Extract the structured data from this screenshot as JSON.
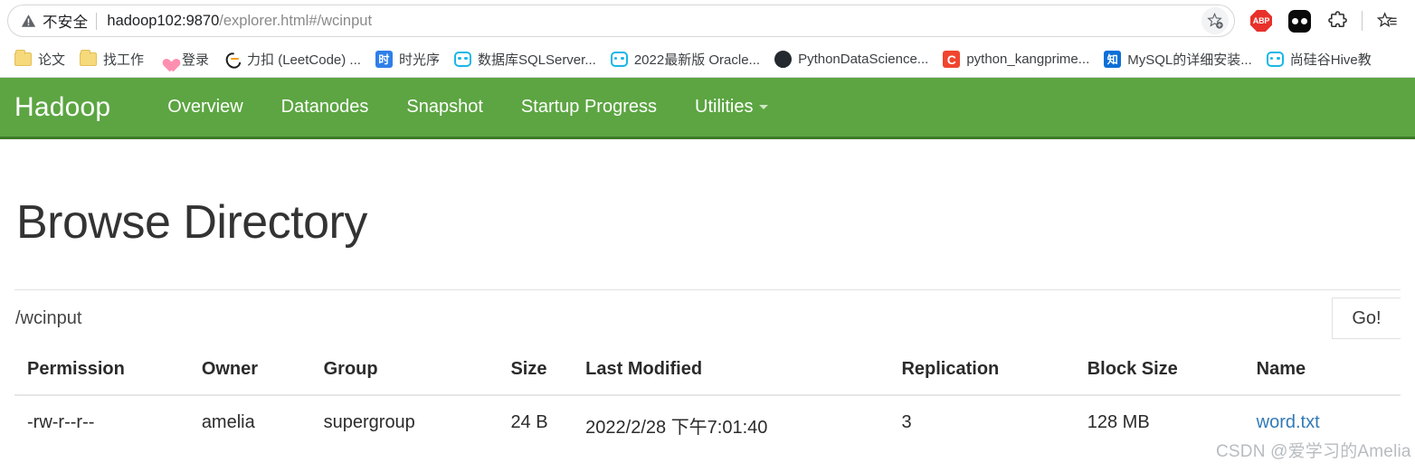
{
  "browser": {
    "security_label": "不安全",
    "url_host": "hadoop102:9870",
    "url_path": "/explorer.html#/wcinput",
    "warning_icon": "warning-triangle-icon",
    "add_favorite_icon": "star-plus-icon",
    "actions": [
      {
        "name": "adblock-plus-icon",
        "label": "ABP"
      },
      {
        "name": "extension-dots-icon",
        "label": ""
      },
      {
        "name": "extensions-puzzle-icon",
        "label": ""
      },
      {
        "name": "collections-icon",
        "label": ""
      }
    ],
    "bookmarks": [
      {
        "label": "论文",
        "icon": "folder-icon"
      },
      {
        "label": "找工作",
        "icon": "folder-icon"
      },
      {
        "label": "登录",
        "icon": "heart-icon"
      },
      {
        "label": "力扣 (LeetCode) ...",
        "icon": "leetcode-icon"
      },
      {
        "label": "时光序",
        "icon": "shiguangxu-icon"
      },
      {
        "label": "数据库SQLServer...",
        "icon": "bilibili-icon"
      },
      {
        "label": "2022最新版 Oracle...",
        "icon": "bilibili-icon"
      },
      {
        "label": "PythonDataScience...",
        "icon": "github-icon"
      },
      {
        "label": "python_kangprime...",
        "icon": "csdn-icon"
      },
      {
        "label": "MySQL的详细安装...",
        "icon": "zhihu-icon"
      },
      {
        "label": "尚硅谷Hive教",
        "icon": "bilibili-icon"
      }
    ]
  },
  "navbar": {
    "brand": "Hadoop",
    "bg_color": "#5ca542",
    "links": [
      {
        "label": "Overview"
      },
      {
        "label": "Datanodes"
      },
      {
        "label": "Snapshot"
      },
      {
        "label": "Startup Progress"
      },
      {
        "label": "Utilities",
        "has_caret": true
      }
    ]
  },
  "page": {
    "title": "Browse Directory",
    "path_value": "/wcinput",
    "go_label": "Go!"
  },
  "table": {
    "headers": [
      "Permission",
      "Owner",
      "Group",
      "Size",
      "Last Modified",
      "Replication",
      "Block Size",
      "Name"
    ],
    "rows": [
      {
        "permission": "-rw-r--r--",
        "owner": "amelia",
        "group": "supergroup",
        "size": "24 B",
        "last_modified": "2022/2/28 下午7:01:40",
        "replication": "3",
        "block_size": "128 MB",
        "name": "word.txt"
      }
    ]
  },
  "watermark": {
    "text": "CSDN @爱学习的Amelia",
    "color": "#b8bcc0"
  }
}
